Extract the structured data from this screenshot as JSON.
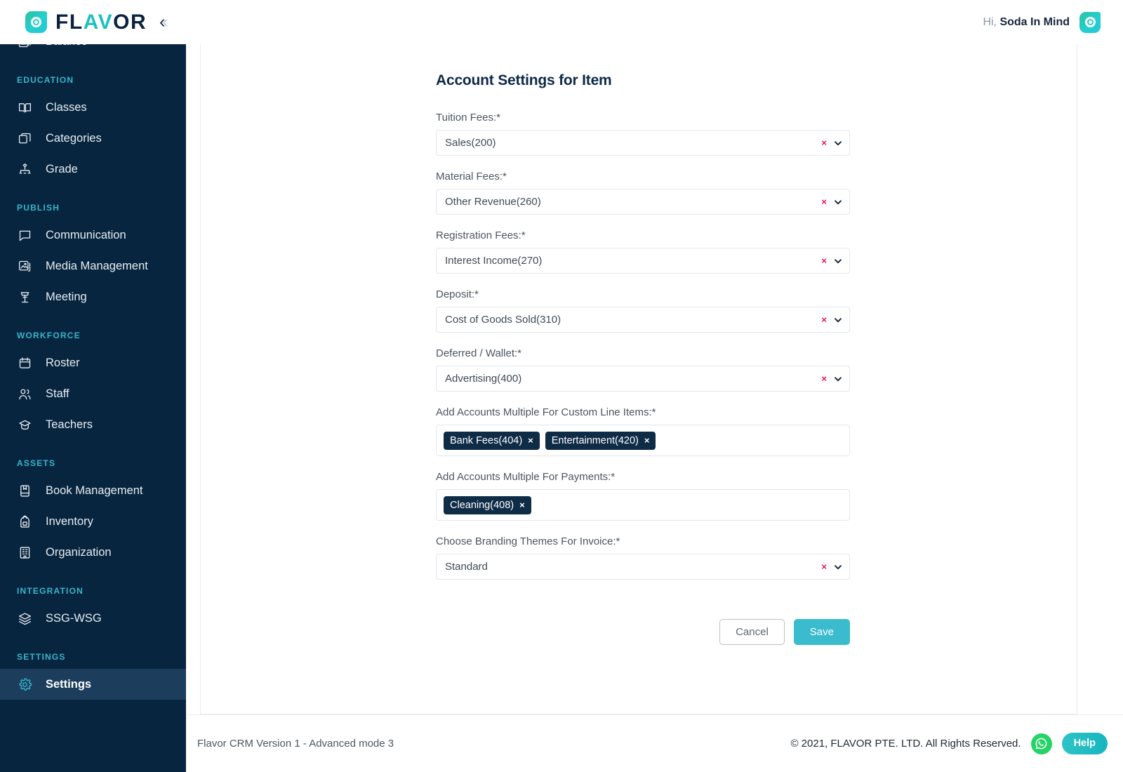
{
  "header": {
    "logo_text_part1": "FL",
    "logo_text_a": "A",
    "logo_text_part2": "V",
    "logo_text_part3": "OR",
    "collapse_icon": "double-chevron-left",
    "greeting_prefix": "Hi,",
    "user_name": "Soda In Mind",
    "avatar_icon": "user-avatar-logo-mark"
  },
  "sidebar": {
    "sections": [
      {
        "label": "",
        "items": [
          {
            "label": "Balance",
            "icon": "balance-stack-icon",
            "active": false
          }
        ]
      },
      {
        "label": "EDUCATION",
        "items": [
          {
            "label": "Classes",
            "icon": "book-open-icon",
            "active": false
          },
          {
            "label": "Categories",
            "icon": "layers-card-icon",
            "active": false
          },
          {
            "label": "Grade",
            "icon": "hierarchy-grade-icon",
            "active": false
          }
        ]
      },
      {
        "label": "PUBLISH",
        "items": [
          {
            "label": "Communication",
            "icon": "chat-bubble-icon",
            "active": false
          },
          {
            "label": "Media Management",
            "icon": "image-stack-icon",
            "active": false
          },
          {
            "label": "Meeting",
            "icon": "podium-icon",
            "active": false
          }
        ]
      },
      {
        "label": "WORKFORCE",
        "items": [
          {
            "label": "Roster",
            "icon": "calendar-icon",
            "active": false
          },
          {
            "label": "Staff",
            "icon": "people-icon",
            "active": false
          },
          {
            "label": "Teachers",
            "icon": "graduation-cap-icon",
            "active": false
          }
        ]
      },
      {
        "label": "ASSETS",
        "items": [
          {
            "label": "Book Management",
            "icon": "book-closed-icon",
            "active": false
          },
          {
            "label": "Inventory",
            "icon": "backpack-icon",
            "active": false
          },
          {
            "label": "Organization",
            "icon": "building-icon",
            "active": false
          }
        ]
      },
      {
        "label": "INTEGRATION",
        "items": [
          {
            "label": "SSG-WSG",
            "icon": "layers-icon",
            "active": false
          }
        ]
      },
      {
        "label": "SETTINGS",
        "items": [
          {
            "label": "Settings",
            "icon": "gear-icon",
            "active": true
          }
        ]
      }
    ]
  },
  "main": {
    "title": "Account Settings for Item",
    "select_fields": [
      {
        "label": "Tuition Fees:*",
        "value": "Sales(200)"
      },
      {
        "label": "Material Fees:*",
        "value": "Other Revenue(260)"
      },
      {
        "label": "Registration Fees:*",
        "value": "Interest Income(270)"
      },
      {
        "label": "Deposit:*",
        "value": "Cost of Goods Sold(310)"
      },
      {
        "label": "Deferred / Wallet:*",
        "value": "Advertising(400)"
      }
    ],
    "tag_fields": [
      {
        "label": "Add Accounts Multiple For Custom Line Items:*",
        "tags": [
          "Bank Fees(404)",
          "Entertainment(420)"
        ]
      },
      {
        "label": "Add Accounts Multiple For Payments:*",
        "tags": [
          "Cleaning(408)"
        ]
      }
    ],
    "branding_field": {
      "label": "Choose Branding Themes For Invoice:*",
      "value": "Standard"
    },
    "clear_symbol": "×",
    "tag_remove_symbol": "×",
    "cancel_label": "Cancel",
    "save_label": "Save"
  },
  "footer": {
    "version_text": "Flavor CRM Version 1 - Advanced mode 3",
    "copyright": "© 2021, FLAVOR PTE. LTD. All Rights Reserved.",
    "whatsapp_icon": "whatsapp-icon",
    "help_label": "Help"
  },
  "colors": {
    "sidebar_bg": "#08253f",
    "sidebar_active_bg": "#1c3e5c",
    "section_label": "#35b6cc",
    "accent_teal": "#3bbcce",
    "clear_pink": "#ea0a5a",
    "tag_navy": "#0f2c47",
    "title_navy": "#0f2947",
    "whatsapp_green": "#25d366"
  }
}
